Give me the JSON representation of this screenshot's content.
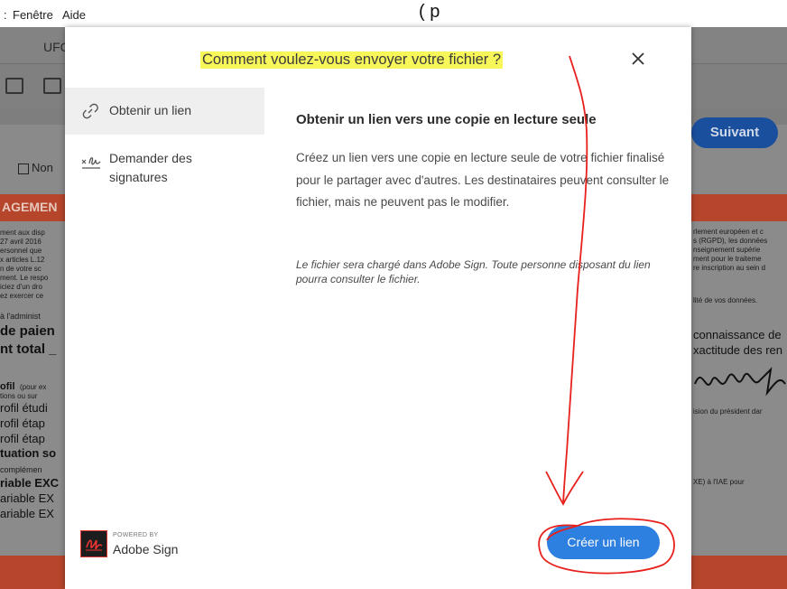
{
  "menubar": {
    "items": [
      ":",
      "Fenêtre",
      "Aide"
    ],
    "top_right_text": "( p"
  },
  "background": {
    "tab_text": "UFC",
    "next_button": "Suivant",
    "checkbox_label": "Non",
    "red_heading": "AGEMEN",
    "left_small_lines": [
      "ment aux disp",
      "27 avril 2016",
      "ersonnel que",
      "x articles L.12",
      "n de votre sc",
      "ment. Le respo",
      "iciez d'un dro",
      "ez exercer ce"
    ],
    "left_admin": "à l'administ",
    "left_big_1": "de paien",
    "left_big_2": "nt total _",
    "left_profil_head": "ofil",
    "left_profil_small": "(pour ex",
    "left_options": "tions ou sur",
    "left_mid_lines": [
      "rofil étudi",
      "rofil étap",
      "rofil étap"
    ],
    "left_situation": "tuation so",
    "left_complement": "complémen",
    "left_variable_bold": "riable EXC",
    "left_variable_lines": [
      "ariable EX",
      "ariable EX"
    ],
    "right_small_lines": [
      "rlement européen et c",
      "s (RGPD), les données",
      "nseignement supérie",
      "ment pour le traiteme",
      "re inscription au sein d"
    ],
    "right_small_extra": "lité de vos données.",
    "right_mid_1": "connaissance de",
    "right_mid_2": "xactitude des ren",
    "right_small_president": "ision du président dar",
    "right_small_iae": "XE) à l'IAE pour"
  },
  "dialog": {
    "title": "Comment voulez-vous envoyer votre fichier ?",
    "close_icon": "close-icon",
    "sidebar": [
      {
        "label": "Obtenir un lien",
        "icon": "link-icon"
      },
      {
        "label": "Demander des signatures",
        "icon": "signature-icon"
      }
    ],
    "content": {
      "title": "Obtenir un lien vers une copie en lecture seule",
      "description": "Créez un lien vers une copie en lecture seule de votre fichier finalisé pour le partager avec d'autres. Les destinataires peuvent consulter le fichier, mais ne peuvent pas le modifier.",
      "note": "Le fichier sera chargé dans Adobe Sign. Toute personne disposant du lien pourra consulter le fichier."
    },
    "primary_button": "Créer un lien",
    "brand": {
      "powered_by": "POWERED BY",
      "name": "Adobe Sign"
    }
  },
  "colors": {
    "primary_blue": "#2d7fe0",
    "highlight": "#f7f75a",
    "annotation_red": "#e8201c",
    "dark_blue_button": "#1a4f9e",
    "adobe_red_bar": "#b5452b"
  }
}
